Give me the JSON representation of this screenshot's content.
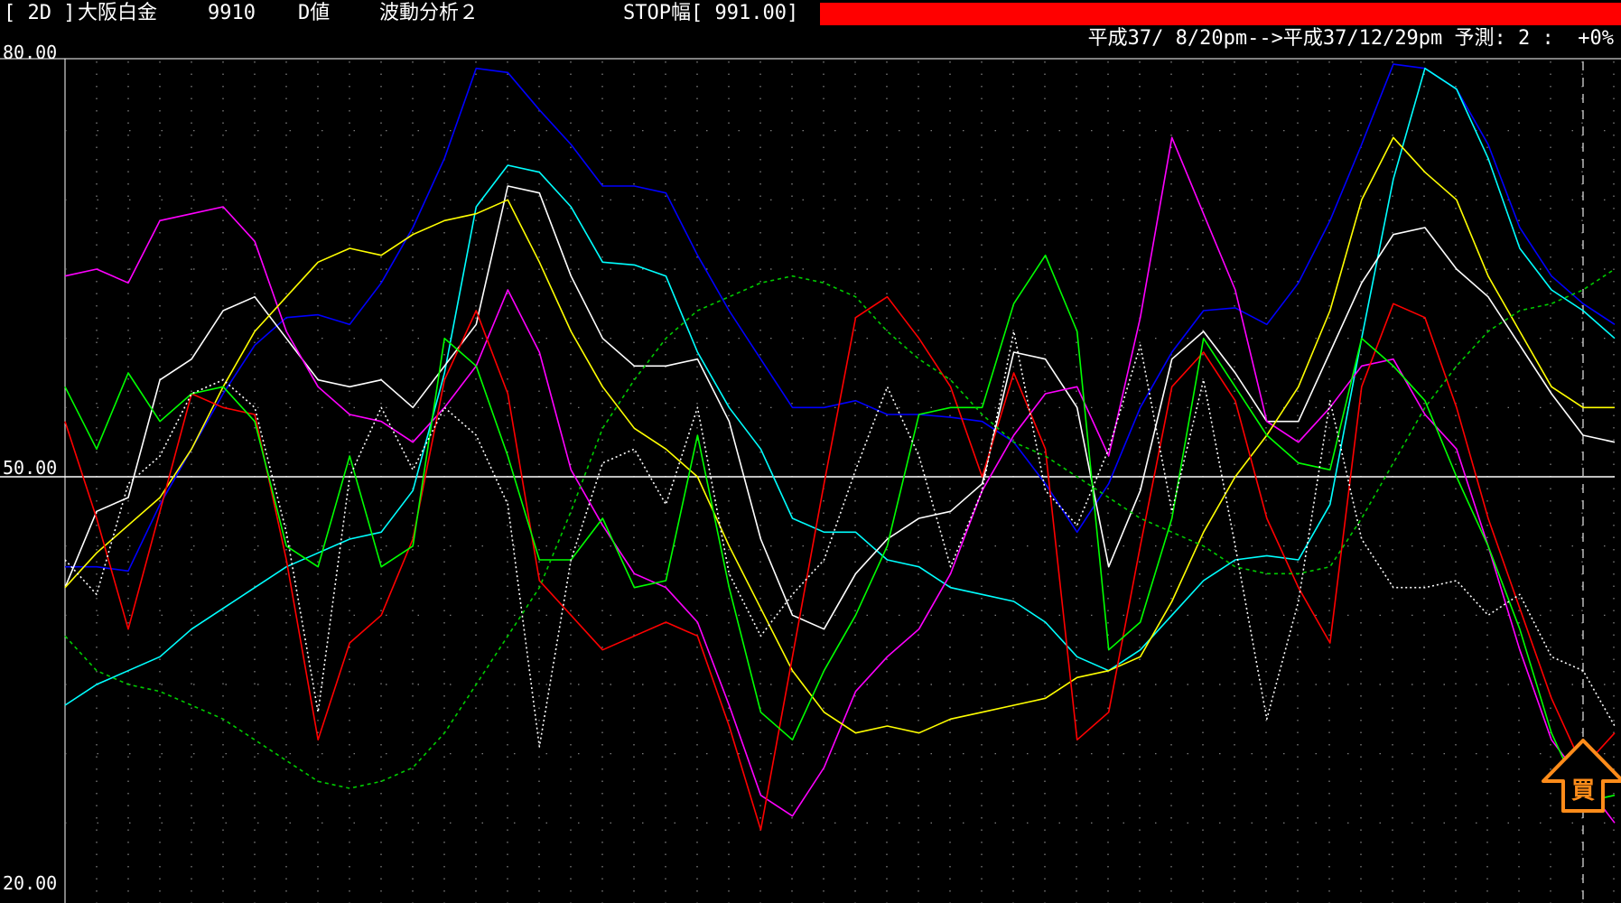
{
  "header": {
    "timeframe": "[ 2D ]",
    "instrument": "大阪白金",
    "code": "9910",
    "value_type": "D値",
    "indicator": "波動分析２",
    "stop_label": "STOP幅[ 991.00]",
    "stop_bar_color": "#ff0000",
    "period": "平成37/ 8/20pm-->平成37/12/29pm 予測: 2 :  +0%"
  },
  "signal": {
    "label": "買",
    "color": "#ff8c1a",
    "icon": "up-arrow-icon",
    "x_index": 48
  },
  "chart_data": {
    "type": "line",
    "ylim": [
      20,
      80
    ],
    "yticks": [
      "80.00",
      "50.00",
      "20.00"
    ],
    "reference_line": 50,
    "x_count": 50,
    "grid": true,
    "forecast_divider_index": 48,
    "series": [
      {
        "color": "#0000ff",
        "dash": "solid",
        "values": [
          43.5,
          43.5,
          43.2,
          48.0,
          52.0,
          56.0,
          59.5,
          61.5,
          61.7,
          61.0,
          64.0,
          68.0,
          73.0,
          79.5,
          79.2,
          76.5,
          74.0,
          71.0,
          71.0,
          70.5,
          66.0,
          62.0,
          58.5,
          55.0,
          55.0,
          55.5,
          54.5,
          54.5,
          54.3,
          54.0,
          52.5,
          49.5,
          46.0,
          49.5,
          55.0,
          59.0,
          62.0,
          62.2,
          61.0,
          64.0,
          68.5,
          74.0,
          79.8,
          79.5,
          78.0,
          74.0,
          68.0,
          64.5,
          62.5,
          61.0
        ]
      },
      {
        "color": "#00ffff",
        "dash": "solid",
        "values": [
          33.5,
          35.0,
          36.0,
          37.0,
          39.0,
          40.5,
          42.0,
          43.5,
          44.5,
          45.5,
          46.0,
          49.0,
          57.5,
          69.5,
          72.5,
          72.0,
          69.5,
          65.5,
          65.3,
          64.5,
          59.0,
          55.0,
          52.0,
          47.0,
          46.0,
          46.0,
          44.0,
          43.5,
          42.0,
          41.5,
          41.0,
          39.5,
          37.0,
          36.0,
          37.5,
          40.0,
          42.5,
          44.0,
          44.3,
          44.0,
          48.0,
          60.0,
          71.5,
          79.5,
          78.0,
          73.0,
          66.5,
          63.5,
          62.0,
          60.0
        ]
      },
      {
        "color": "#ffffff",
        "dash": "solid",
        "values": [
          42.0,
          47.5,
          48.5,
          57.0,
          58.5,
          62.0,
          63.0,
          60.0,
          57.0,
          56.5,
          57.0,
          55.0,
          58.0,
          61.0,
          71.0,
          70.5,
          64.5,
          60.0,
          58.0,
          58.0,
          58.5,
          54.0,
          45.5,
          40.0,
          39.0,
          43.0,
          45.5,
          47.0,
          47.5,
          49.5,
          59.0,
          58.5,
          55.0,
          43.5,
          49.0,
          58.5,
          60.5,
          57.5,
          54.0,
          54.0,
          59.0,
          64.0,
          67.5,
          68.0,
          65.0,
          63.0,
          59.5,
          56.0,
          53.0,
          52.5
        ]
      },
      {
        "color": "#ff00ff",
        "dash": "solid",
        "values": [
          64.5,
          65.0,
          64.0,
          68.5,
          69.0,
          69.5,
          67.0,
          60.5,
          56.5,
          54.5,
          54.0,
          52.5,
          55.0,
          58.0,
          63.5,
          59.0,
          50.5,
          46.5,
          43.0,
          42.0,
          39.5,
          33.5,
          27.0,
          25.5,
          29.0,
          34.5,
          37.0,
          39.0,
          43.0,
          49.0,
          53.0,
          56.0,
          56.5,
          51.5,
          61.5,
          74.5,
          69.0,
          63.5,
          54.0,
          52.5,
          55.0,
          58.0,
          58.5,
          54.5,
          52.0,
          45.0,
          37.5,
          31.0,
          28.0,
          25.0
        ]
      },
      {
        "color": "#ffff00",
        "dash": "solid",
        "values": [
          42.0,
          44.5,
          46.5,
          48.5,
          52.0,
          56.5,
          60.5,
          63.0,
          65.5,
          66.5,
          66.0,
          67.5,
          68.5,
          69.0,
          70.0,
          65.5,
          60.5,
          56.5,
          53.5,
          52.0,
          50.0,
          45.0,
          40.5,
          36.0,
          33.0,
          31.5,
          32.0,
          31.5,
          32.5,
          33.0,
          33.5,
          34.0,
          35.5,
          36.0,
          37.0,
          41.0,
          46.0,
          50.0,
          53.0,
          56.5,
          62.0,
          70.0,
          74.5,
          72.0,
          70.0,
          64.5,
          60.5,
          56.5,
          55.0,
          55.0
        ]
      },
      {
        "color": "#ff0000",
        "dash": "solid",
        "values": [
          54.0,
          47.0,
          39.0,
          47.5,
          56.0,
          55.0,
          54.5,
          44.0,
          31.0,
          38.0,
          40.0,
          45.5,
          57.0,
          62.0,
          56.0,
          42.5,
          40.0,
          37.5,
          38.5,
          39.5,
          38.5,
          32.0,
          24.5,
          37.0,
          49.5,
          61.5,
          63.0,
          60.0,
          56.5,
          50.0,
          57.5,
          52.0,
          31.0,
          33.0,
          45.0,
          56.5,
          59.0,
          55.5,
          47.0,
          42.0,
          38.0,
          56.5,
          62.5,
          61.5,
          55.0,
          47.0,
          40.5,
          34.0,
          29.0,
          31.5
        ]
      },
      {
        "color": "#00ff00",
        "dash": "solid",
        "values": [
          56.5,
          52.0,
          57.5,
          54.0,
          56.0,
          56.5,
          54.0,
          45.0,
          43.5,
          51.5,
          43.5,
          45.0,
          60.0,
          58.0,
          51.5,
          44.0,
          44.0,
          47.0,
          42.0,
          42.5,
          53.0,
          42.0,
          33.0,
          31.0,
          36.0,
          40.0,
          45.0,
          54.5,
          55.0,
          55.0,
          62.5,
          66.0,
          60.5,
          37.5,
          39.5,
          47.0,
          60.0,
          56.5,
          53.0,
          51.0,
          50.5,
          60.0,
          58.0,
          55.5,
          50.0,
          45.0,
          39.0,
          31.5,
          26.5,
          27.0
        ]
      },
      {
        "color": "#ffffff",
        "dash": "2,3",
        "values": [
          44.0,
          41.5,
          49.5,
          51.5,
          56.0,
          57.0,
          55.0,
          46.0,
          33.0,
          50.0,
          55.0,
          50.5,
          55.0,
          53.0,
          48.0,
          30.5,
          44.0,
          51.0,
          52.0,
          48.0,
          55.0,
          43.0,
          38.5,
          41.5,
          44.0,
          50.5,
          56.5,
          51.5,
          43.5,
          49.0,
          60.5,
          49.0,
          46.5,
          52.0,
          59.5,
          47.5,
          57.0,
          45.0,
          32.5,
          41.0,
          55.5,
          45.5,
          42.0,
          42.0,
          42.5,
          40.0,
          41.5,
          37.0,
          36.0,
          32.0
        ]
      },
      {
        "color": "#00cc00",
        "dash": "4,4",
        "values": [
          38.5,
          36.0,
          35.0,
          34.5,
          33.5,
          32.5,
          31.0,
          29.5,
          28.0,
          27.5,
          28.0,
          29.0,
          31.5,
          35.0,
          38.5,
          42.0,
          47.5,
          53.5,
          57.0,
          60.0,
          62.0,
          63.0,
          64.0,
          64.5,
          64.0,
          63.0,
          60.5,
          58.5,
          57.0,
          54.5,
          52.5,
          51.5,
          50.0,
          48.5,
          47.0,
          46.0,
          45.0,
          43.5,
          43.0,
          43.0,
          43.5,
          47.0,
          51.0,
          55.0,
          58.0,
          60.5,
          62.0,
          62.5,
          63.5,
          65.0
        ]
      }
    ]
  }
}
